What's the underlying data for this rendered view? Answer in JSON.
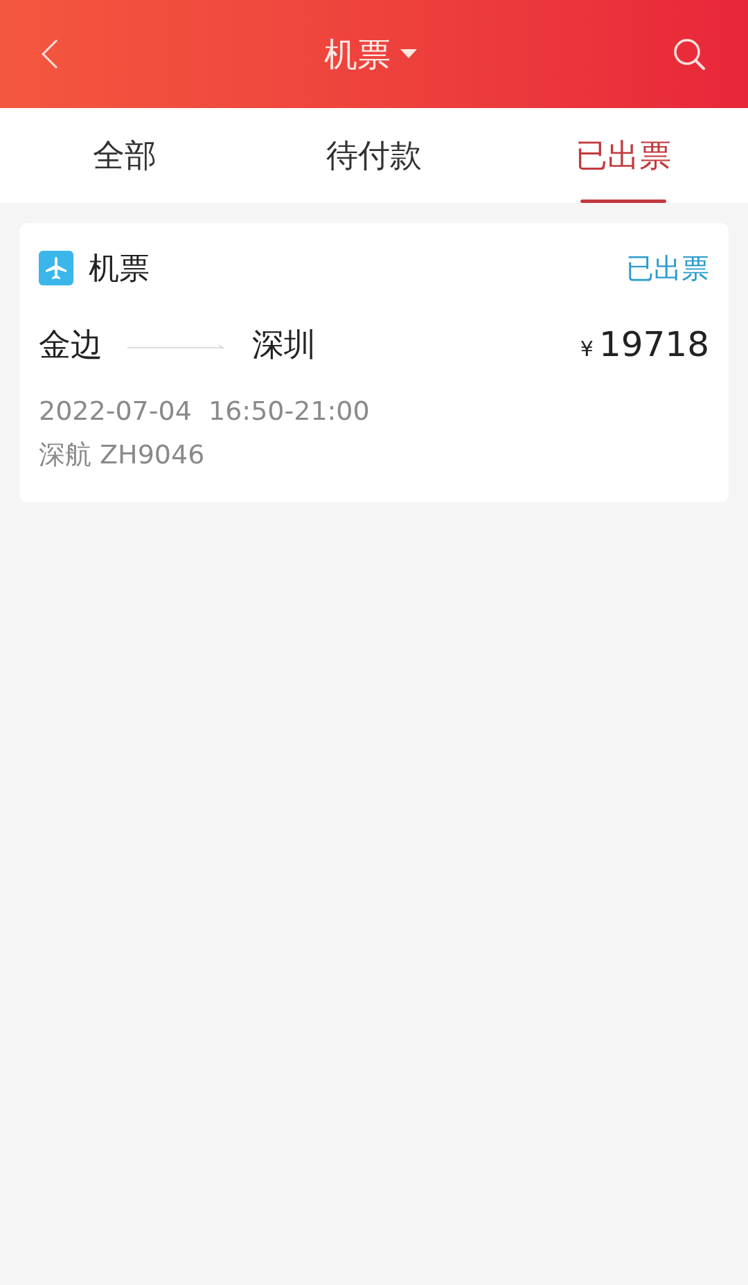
{
  "header": {
    "title": "机票"
  },
  "tabs": [
    {
      "label": "全部",
      "selected": false
    },
    {
      "label": "待付款",
      "selected": false
    },
    {
      "label": "已出票",
      "selected": true
    }
  ],
  "orders": [
    {
      "type": "机票",
      "status": "已出票",
      "from": "金边",
      "to": "深圳",
      "currency": "¥",
      "price": "19718",
      "datetime": "2022-07-04  16:50-21:00",
      "flight": "深航 ZH9046"
    }
  ]
}
